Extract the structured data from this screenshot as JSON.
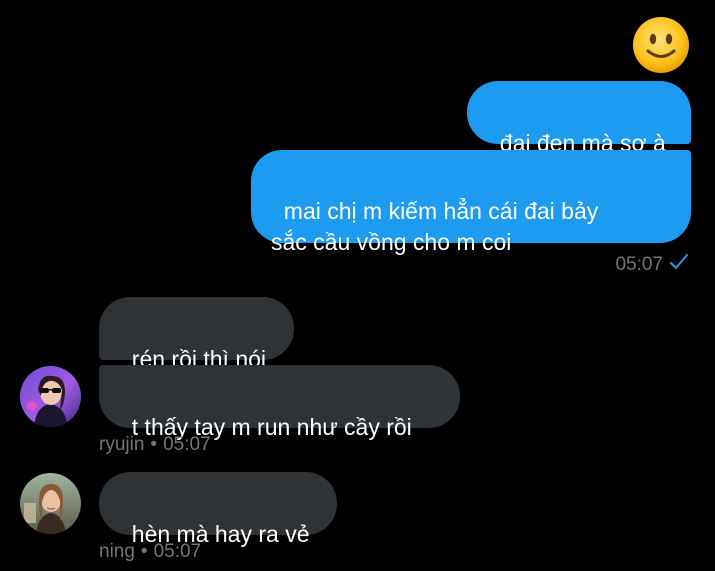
{
  "reaction": {
    "emoji_name": "slightly-smiling-face"
  },
  "messages_out": [
    {
      "text": "đai đen mà sợ à"
    },
    {
      "text": "mai chị m kiếm hẳn cái đai bảy\nsắc cầu vồng cho m coi"
    }
  ],
  "out_meta": {
    "time": "05:07",
    "status_icon": "check-icon"
  },
  "groups_in": [
    {
      "sender": "ryujin",
      "time": "05:07",
      "avatar": "ryujin-avatar",
      "messages": [
        {
          "text": "rén rồi thì nói"
        },
        {
          "text": "t thấy tay m run như cầy rồi"
        }
      ]
    },
    {
      "sender": "ning",
      "time": "05:07",
      "avatar": "ning-avatar",
      "messages": [
        {
          "text": "hèn mà hay ra vẻ"
        }
      ]
    }
  ],
  "separator": "•",
  "colors": {
    "background": "#000000",
    "outgoing_bubble": "#1d9bf0",
    "incoming_bubble": "#2f3336",
    "meta_text": "#71767b",
    "check": "#1d9bf0"
  }
}
